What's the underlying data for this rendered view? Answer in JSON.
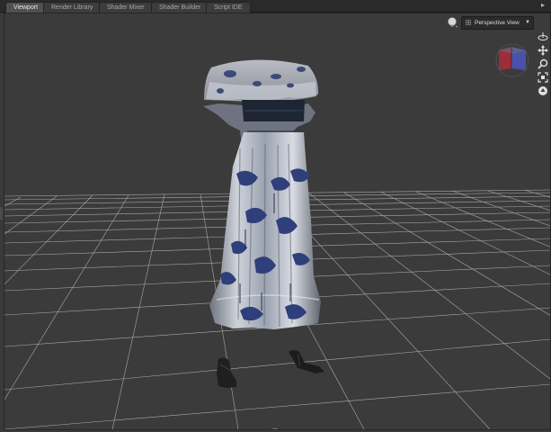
{
  "tabs": [
    {
      "label": "Viewport",
      "active": true
    },
    {
      "label": "Render Library",
      "active": false
    },
    {
      "label": "Shader Mixer",
      "active": false
    },
    {
      "label": "Shader Builder",
      "active": false
    },
    {
      "label": "Script IDE",
      "active": false
    }
  ],
  "panel_menu_icon": "panel-menu-icon",
  "viewport": {
    "view_label": "Perspective View",
    "view_dropdown_icon": "chevron-down-icon",
    "icons": [
      "light-bulb-icon",
      "grid-icon",
      "view-cube-icon",
      "orbit-icon",
      "pan-icon",
      "zoom-icon",
      "frame-icon",
      "reset-icon"
    ]
  },
  "colors": {
    "background": "#3b3b3b",
    "grid_line": "#b0b0b0",
    "tab_active": "#505050",
    "tab_inactive": "#3c3c3c",
    "cube_red": "#9a2f3a",
    "cube_blue": "#4852a8"
  }
}
